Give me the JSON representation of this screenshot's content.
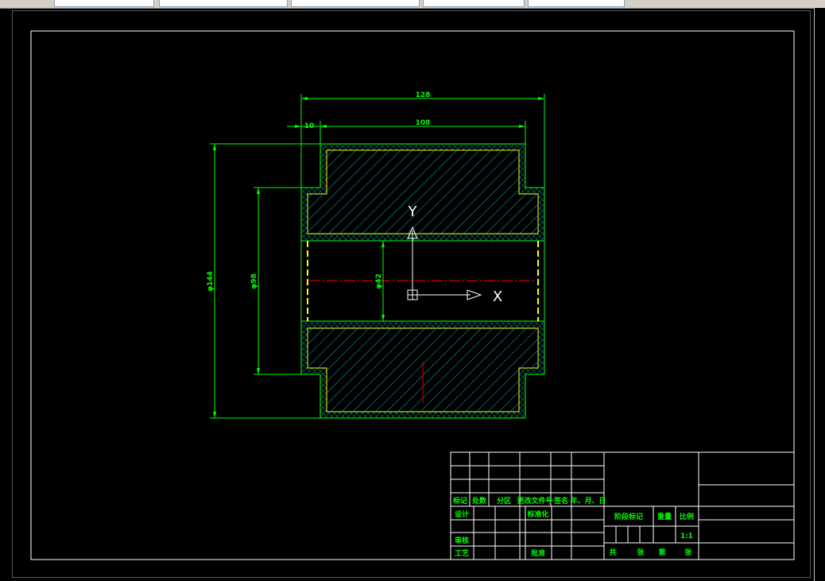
{
  "dimensions": {
    "overall_length": "128",
    "length_108": "108",
    "offset_10": "10",
    "dia_outer": "φ144",
    "dia_hub": "φ98",
    "dia_bore": "φ42"
  },
  "ucs": {
    "x_label": "X",
    "y_label": "Y"
  },
  "title_block": {
    "header": [
      "标记",
      "处数",
      "分区",
      "更改文件号",
      "签名",
      "年、月、日"
    ],
    "design": "设计",
    "standardization": "标准化",
    "review": "审核",
    "process": "工艺",
    "approve": "批准",
    "stage_mark": "阶段标记",
    "weight": "重量",
    "scale_label": "比例",
    "scale_value": "1:1",
    "sheet_total": "共",
    "sheet_unit_1": "张",
    "sheet_nth": "第",
    "sheet_unit_2": "张"
  },
  "colors": {
    "dimension": "#00ff00",
    "outline": "#00ff00",
    "hatch": "#00b8b8",
    "center_line": "#ff0000",
    "hidden_edge": "#ffff00",
    "frame": "#ffffff"
  }
}
